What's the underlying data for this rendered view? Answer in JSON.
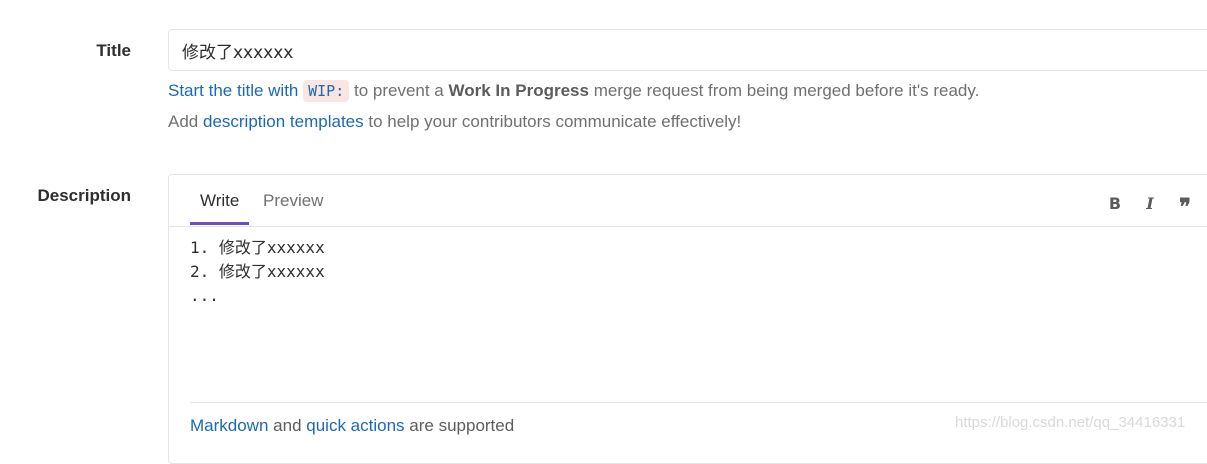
{
  "form": {
    "title_label": "Title",
    "title_value": "修改了xxxxxx",
    "help_line1": {
      "link_start": "Start the title with",
      "code": "WIP:",
      "text_prevent": "to prevent a",
      "bold": "Work In Progress",
      "text_rest": "merge request from being merged before it's ready."
    },
    "help_line2": {
      "text_add": "Add",
      "link_templates": "description templates",
      "text_rest": "to help your contributors communicate effectively!"
    },
    "description_label": "Description"
  },
  "editor": {
    "tabs": [
      {
        "label": "Write",
        "active": true
      },
      {
        "label": "Preview",
        "active": false
      }
    ],
    "toolbar": {
      "bold": "B",
      "italic": "I",
      "quote": "❞"
    },
    "content": "1. 修改了xxxxxx\n2. 修改了xxxxxx\n...",
    "footer": {
      "link_markdown": "Markdown",
      "text_and": "and",
      "link_quick_actions": "quick actions",
      "text_supported": "are supported"
    },
    "active_tab_color": "#6b4fbb"
  },
  "watermark": "https://blog.csdn.net/qq_34416331",
  "colors": {
    "link": "#1b69b6",
    "muted": "#707070",
    "code_bg": "#fbe5e1",
    "border": "#e5e5e5"
  }
}
